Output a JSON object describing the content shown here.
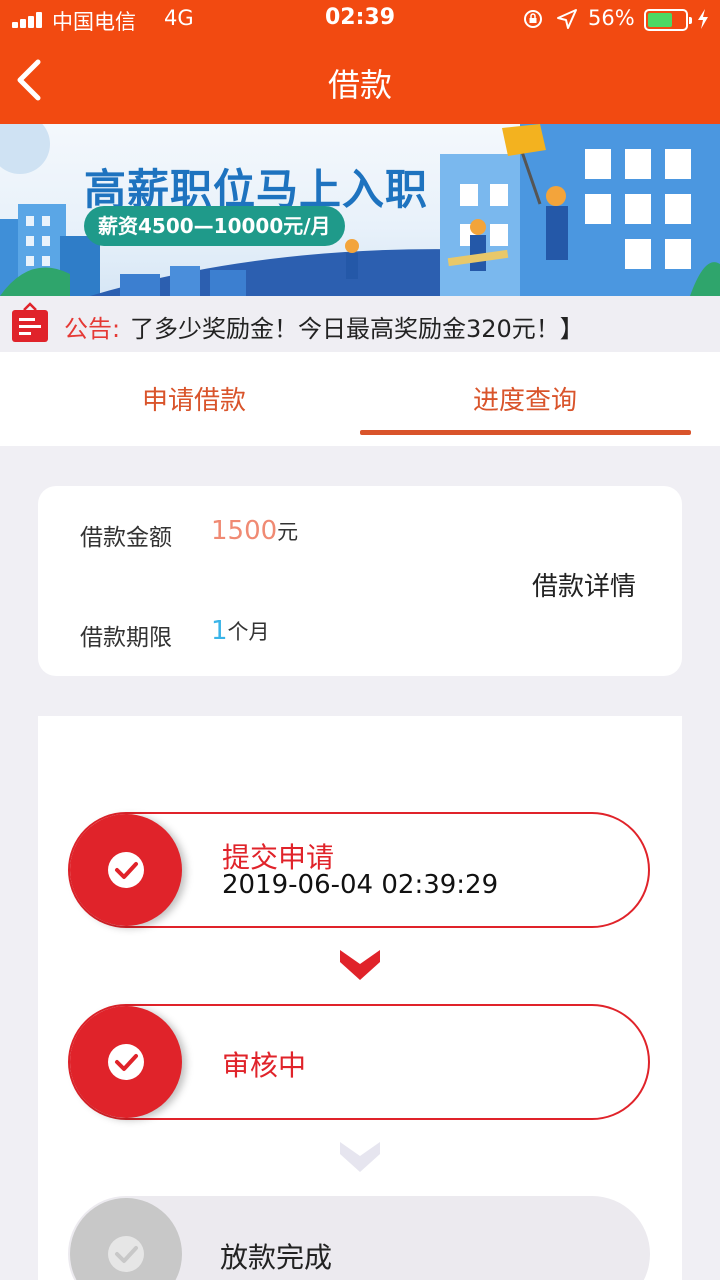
{
  "status_bar": {
    "carrier": "中国电信",
    "network": "4G",
    "time": "02:39",
    "battery": "56%"
  },
  "nav": {
    "title": "借款"
  },
  "banner": {
    "headline": "高薪职位马上入职",
    "salary": "薪资4500—10000元/月"
  },
  "notice": {
    "label": "公告:",
    "text": "了多少奖励金！今日最高奖励金320元！】"
  },
  "tabs": [
    {
      "label": "申请借款"
    },
    {
      "label": "进度查询"
    }
  ],
  "loan": {
    "amount_label": "借款金额",
    "amount_value": "1500",
    "amount_unit": "元",
    "term_label": "借款期限",
    "term_value": "1",
    "term_unit": "个月",
    "detail_link": "借款详情"
  },
  "progress": {
    "steps": [
      {
        "title": "提交申请",
        "time": "2019-06-04 02:39:29",
        "state": "done"
      },
      {
        "title": "审核中",
        "state": "done"
      },
      {
        "title": "放款完成",
        "state": "pending"
      }
    ]
  },
  "colors": {
    "nav_bg": "#f24a11",
    "accent_red": "#e0232a",
    "tab_orange": "#d9542b",
    "amount": "#f08a73",
    "term": "#3ab4e8"
  }
}
